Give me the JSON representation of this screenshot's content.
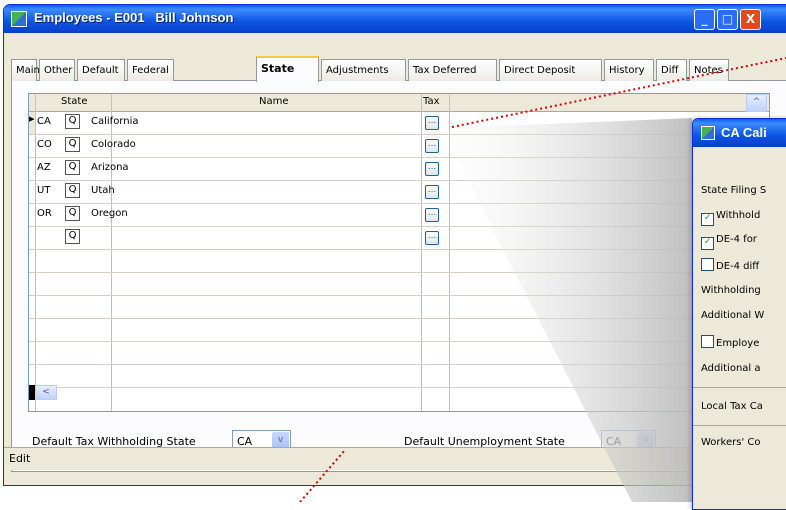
{
  "window": {
    "title": "Employees - E001   Bill Johnson",
    "minimize_glyph": "_",
    "maximize_glyph": "□",
    "close_glyph": "X"
  },
  "tabs": [
    {
      "label": "Main"
    },
    {
      "label": "Other"
    },
    {
      "label": "Default"
    },
    {
      "label": "Federal"
    },
    {
      "label": "State"
    },
    {
      "label": "Adjustments"
    },
    {
      "label": "Tax Deferred"
    },
    {
      "label": "Direct Deposit"
    },
    {
      "label": "History"
    },
    {
      "label": "Diff"
    },
    {
      "label": "Notes"
    }
  ],
  "grid": {
    "headers": {
      "state": "State",
      "name": "Name",
      "tax": "Tax"
    },
    "rows": [
      {
        "code": "CA",
        "name": "California"
      },
      {
        "code": "CO",
        "name": "Colorado"
      },
      {
        "code": "AZ",
        "name": "Arizona"
      },
      {
        "code": "UT",
        "name": "Utah"
      },
      {
        "code": "OR",
        "name": "Oregon"
      },
      {
        "code": "",
        "name": ""
      }
    ],
    "lookup_glyph": "Q",
    "tax_glyph": "...",
    "scroll_up_glyph": "^",
    "scroll_left_glyph": "<"
  },
  "footer": {
    "withholding_label": "Default Tax Withholding State",
    "withholding_value": "CA",
    "unemployment_label": "Default Unemployment State",
    "unemployment_value": "CA",
    "dropdown_glyph": "v"
  },
  "status": {
    "text": "Edit"
  },
  "popup": {
    "title": "CA Cali",
    "lines": [
      {
        "text": "State Filing S",
        "checkbox": false
      },
      {
        "text": "Withhold",
        "checkbox": true,
        "checked": true
      },
      {
        "text": "DE-4 for",
        "checkbox": true,
        "checked": true
      },
      {
        "text": "DE-4 diff",
        "checkbox": true,
        "checked": false
      },
      {
        "text": "Withholding",
        "checkbox": false
      },
      {
        "text": "Additional W",
        "checkbox": false
      },
      {
        "text": "Employe",
        "checkbox": true,
        "checked": false
      },
      {
        "text": "Additional a",
        "checkbox": false
      },
      {
        "text": "Local Tax Ca",
        "checkbox": false
      },
      {
        "text": "Workers' Co",
        "checkbox": false
      }
    ],
    "check_glyph": "✓"
  },
  "colors": {
    "title_blue": "#0c54e2",
    "tab_highlight": "#ffc83c",
    "callout_red": "#d40000"
  }
}
